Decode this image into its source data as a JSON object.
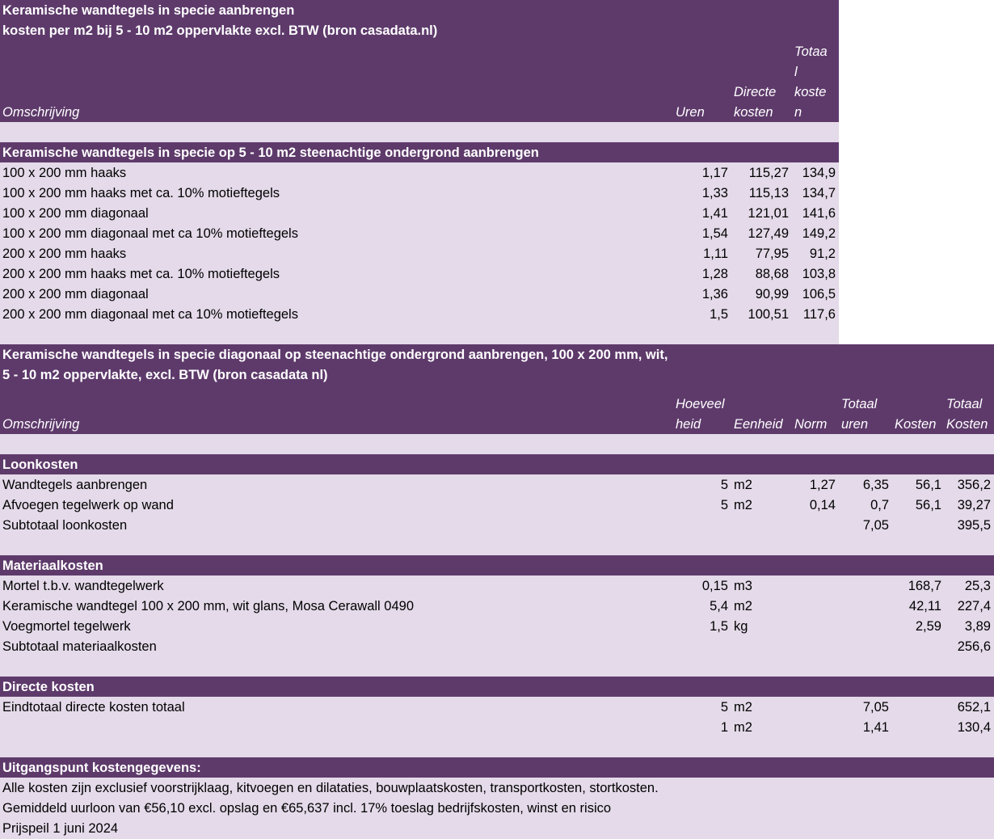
{
  "table1": {
    "title_line1": "Keramische wandtegels in specie aanbrengen",
    "title_line2": "kosten per m2 bij 5 - 10 m2 oppervlakte excl. BTW (bron casadata.nl)",
    "col_omschrijving": "Omschrijving",
    "col_uren": "Uren",
    "col_directe_1": "Directe",
    "col_directe_2": "kosten",
    "col_totaal_1": "Totaa",
    "col_totaal_2": "l",
    "col_totaal_3": "koste",
    "col_totaal_4": "n",
    "section_title": "Keramische wandtegels in specie op 5 - 10 m2 steenachtige ondergrond aanbrengen",
    "rows": [
      {
        "label": "100 x 200 mm haaks",
        "uren": "1,17",
        "directe": "115,27",
        "totaal": "134,9"
      },
      {
        "label": "100 x 200 mm haaks met ca. 10% motieftegels",
        "uren": "1,33",
        "directe": "115,13",
        "totaal": "134,7"
      },
      {
        "label": "100 x 200 mm diagonaal",
        "uren": "1,41",
        "directe": "121,01",
        "totaal": "141,6"
      },
      {
        "label": "100 x 200 mm diagonaal met ca 10% motieftegels",
        "uren": "1,54",
        "directe": "127,49",
        "totaal": "149,2"
      },
      {
        "label": "200 x 200 mm haaks",
        "uren": "1,11",
        "directe": "77,95",
        "totaal": "91,2"
      },
      {
        "label": "200 x 200 mm haaks met ca. 10% motieftegels",
        "uren": "1,28",
        "directe": "88,68",
        "totaal": "103,8"
      },
      {
        "label": "200 x 200 mm diagonaal",
        "uren": "1,36",
        "directe": "90,99",
        "totaal": "106,5"
      },
      {
        "label": "200 x 200 mm diagonaal met ca 10% motieftegels",
        "uren": "1,5",
        "directe": "100,51",
        "totaal": "117,6"
      }
    ]
  },
  "table2": {
    "title_line1": "Keramische wandtegels in specie diagonaal op steenachtige ondergrond aanbrengen, 100 x 200 mm, wit,",
    "title_line2": "5 - 10 m2 oppervlakte, excl. BTW (bron casadata nl)",
    "col_omschrijving": "Omschrijving",
    "col_hoeveel_1": "Hoeveel",
    "col_hoeveel_2": "heid",
    "col_eenheid": "Eenheid",
    "col_norm": "Norm",
    "col_tot_uren_1": "Totaal",
    "col_tot_uren_2": "uren",
    "col_kosten": "Kosten",
    "col_tot_kosten_1": "Totaal",
    "col_tot_kosten_2": "Kosten",
    "loon": {
      "title": "Loonkosten",
      "rows": [
        {
          "label": "Wandtegels aanbrengen",
          "hoeveelheid": "5",
          "eenheid": "m2",
          "norm": "1,27",
          "uren": "6,35",
          "kosten": "56,1",
          "totaal": "356,2"
        },
        {
          "label": "Afvoegen tegelwerk op wand",
          "hoeveelheid": "5",
          "eenheid": "m2",
          "norm": "0,14",
          "uren": "0,7",
          "kosten": "56,1",
          "totaal": "39,27"
        }
      ],
      "subtotal_label": "Subtotaal loonkosten",
      "subtotal_uren": "7,05",
      "subtotal_totaal": "395,5"
    },
    "materiaal": {
      "title": "Materiaalkosten",
      "rows": [
        {
          "label": "Mortel t.b.v. wandtegelwerk",
          "hoeveelheid": "0,15",
          "eenheid": "m3",
          "kosten": "168,7",
          "totaal": "25,3"
        },
        {
          "label": "Keramische wandtegel 100 x 200 mm, wit glans, Mosa Cerawall 0490",
          "hoeveelheid": "5,4",
          "eenheid": "m2",
          "kosten": "42,11",
          "totaal": "227,4"
        },
        {
          "label": "Voegmortel tegelwerk",
          "hoeveelheid": "1,5",
          "eenheid": "kg",
          "kosten": "2,59",
          "totaal": "3,89"
        }
      ],
      "subtotal_label": "Subtotaal materiaalkosten",
      "subtotal_totaal": "256,6"
    },
    "directe": {
      "title": "Directe kosten",
      "rows": [
        {
          "label": "Eindtotaal directe kosten totaal",
          "hoeveelheid": "5",
          "eenheid": "m2",
          "uren": "7,05",
          "totaal": "652,1"
        },
        {
          "label": "",
          "hoeveelheid": "1",
          "eenheid": "m2",
          "uren": "1,41",
          "totaal": "130,4"
        }
      ]
    },
    "uitgangspunt": {
      "title": "Uitgangspunt kostengegevens:",
      "lines": [
        "Alle kosten zijn exclusief voorstrijklaag, kitvoegen en dilataties, bouwplaatskosten, transportkosten, stortkosten.",
        "Gemiddeld uurloon van €56,10 excl. opslag en €65,637 incl. 17% toeslag bedrijfskosten, winst en risico",
        "Prijspeil 1 juni 2024"
      ]
    }
  }
}
